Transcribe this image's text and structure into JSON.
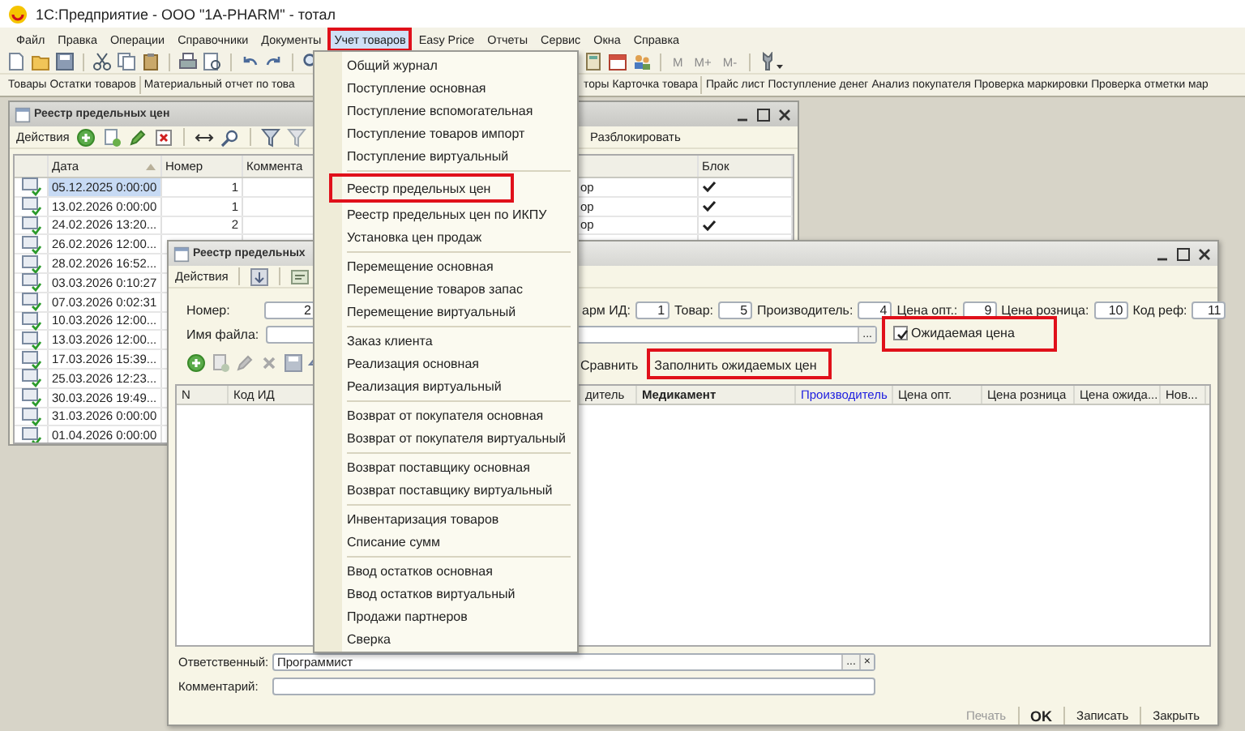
{
  "window": {
    "title": "1С:Предприятие - ООО \"1A-PHARM\" - тотал"
  },
  "menu_bar": [
    {
      "label": "Файл",
      "selected": false,
      "highlighted": false
    },
    {
      "label": "Правка",
      "selected": false,
      "highlighted": false
    },
    {
      "label": "Операции",
      "selected": false,
      "highlighted": false
    },
    {
      "label": "Справочники",
      "selected": false,
      "highlighted": false
    },
    {
      "label": "Документы",
      "selected": false,
      "highlighted": false
    },
    {
      "label": "Учет товаров",
      "selected": true,
      "highlighted": true
    },
    {
      "label": "Easy Price",
      "selected": false,
      "highlighted": false
    },
    {
      "label": "Отчеты",
      "selected": false,
      "highlighted": false
    },
    {
      "label": "Сервис",
      "selected": false,
      "highlighted": false
    },
    {
      "label": "Окна",
      "selected": false,
      "highlighted": false
    },
    {
      "label": "Справка",
      "selected": false,
      "highlighted": false
    }
  ],
  "toolbar": {
    "memory_buttons": [
      "М",
      "М+",
      "М-"
    ]
  },
  "quick_bar": {
    "left": [
      [
        "Товары",
        "Остатки товаров"
      ],
      [
        "Материальный отчет по това"
      ]
    ],
    "right": [
      [
        "торы",
        "Карточка товара"
      ],
      [
        "Прайс лист",
        "Поступление денег",
        "Анализ покупателя",
        "Проверка маркировки",
        "Проверка отметки мар"
      ]
    ]
  },
  "list_window": {
    "title": "Реестр предельных цен",
    "actions": "Действия",
    "unblock_button": "Разблокировать",
    "columns": [
      "Дата",
      "Номер",
      "Коммента"
    ],
    "block_column": "Блок",
    "rows": [
      {
        "date": "05.12.2025 0:00:00",
        "number": "1",
        "column_5": "ор",
        "blocked": true,
        "selected": true
      },
      {
        "date": "13.02.2026 0:00:00",
        "number": "1",
        "column_5": "ор",
        "blocked": true,
        "selected": false
      },
      {
        "date": "24.02.2026 13:20...",
        "number": "2",
        "column_5": "ор",
        "blocked": true,
        "selected": false
      },
      {
        "date": "26.02.2026 12:00...",
        "selected": false
      },
      {
        "date": "28.02.2026 16:52...",
        "selected": false
      },
      {
        "date": "03.03.2026 0:10:27",
        "selected": false
      },
      {
        "date": "07.03.2026 0:02:31",
        "selected": false
      },
      {
        "date": "10.03.2026 12:00...",
        "selected": false
      },
      {
        "date": "13.03.2026 12:00...",
        "selected": false
      },
      {
        "date": "17.03.2026 15:39...",
        "selected": false
      },
      {
        "date": "25.03.2026 12:23...",
        "selected": false
      },
      {
        "date": "30.03.2026 19:49...",
        "selected": false
      },
      {
        "date": "31.03.2026 0:00:00",
        "selected": false
      },
      {
        "date": "01.04.2026 0:00:00",
        "selected": false
      }
    ]
  },
  "form_window": {
    "title": "Реестр предельных",
    "actions": "Действия",
    "number": {
      "label": "Номер:",
      "value": "2"
    },
    "id_fields": [
      {
        "label": "арм ИД:",
        "value": "1"
      },
      {
        "label": "Товар:",
        "value": "5"
      },
      {
        "label": "Производитель:",
        "value": "4"
      },
      {
        "label": "Цена опт.:",
        "value": "9"
      },
      {
        "label": "Цена розница:",
        "value": "10"
      },
      {
        "label": "Код реф:",
        "value": "11"
      }
    ],
    "file": {
      "label": "Имя файла:",
      "select_button": "..."
    },
    "expected_price": {
      "label": "Ожидаемая цена",
      "checked": true,
      "highlighted": true
    },
    "buttons": [
      {
        "label": "Сравнить",
        "highlighted": false
      },
      {
        "label": "Заполнить ожидаемых цен",
        "highlighted": true
      }
    ],
    "columns": [
      {
        "label": "N",
        "kind": "plain"
      },
      {
        "label": "Код ИД",
        "kind": "plain"
      },
      {
        "label": "дитель",
        "kind": "plain"
      },
      {
        "label": "Медикамент",
        "kind": "bold"
      },
      {
        "label": "Производитель",
        "kind": "link"
      },
      {
        "label": "Цена опт.",
        "kind": "plain"
      },
      {
        "label": "Цена розница",
        "kind": "plain"
      },
      {
        "label": "Цена ожида...",
        "kind": "plain"
      },
      {
        "label": "Нов...",
        "kind": "plain"
      }
    ],
    "responsible": {
      "label": "Ответственный:",
      "value": "Программист",
      "select_button": "...",
      "clear_button": "×"
    },
    "comment": {
      "label": "Комментарий:"
    },
    "footer": [
      {
        "label": "Печать",
        "disabled": true,
        "default": false
      },
      {
        "label": "OK",
        "disabled": false,
        "default": true
      },
      {
        "label": "Записать",
        "disabled": false,
        "default": false
      },
      {
        "label": "Закрыть",
        "disabled": false,
        "default": false
      }
    ]
  },
  "dropdown_menu": {
    "groups": [
      [
        {
          "label": "Общий журнал",
          "highlighted": false
        },
        {
          "label": "Поступление основная",
          "highlighted": false
        },
        {
          "label": "Поступление вспомогательная",
          "highlighted": false
        },
        {
          "label": "Поступление товаров импорт",
          "highlighted": false
        },
        {
          "label": "Поступление виртуальный",
          "highlighted": false
        }
      ],
      [
        {
          "label": "Реестр предельных цен",
          "highlighted": true
        },
        {
          "label": "Реестр предельных цен по ИКПУ",
          "highlighted": false
        },
        {
          "label": "Установка цен продаж",
          "highlighted": false
        }
      ],
      [
        {
          "label": "Перемещение основная",
          "highlighted": false
        },
        {
          "label": "Перемещение товаров запас",
          "highlighted": false
        },
        {
          "label": "Перемещение виртуальный",
          "highlighted": false
        }
      ],
      [
        {
          "label": "Заказ клиента",
          "highlighted": false
        },
        {
          "label": "Реализация основная",
          "highlighted": false
        },
        {
          "label": "Реализация виртуальный",
          "highlighted": false
        }
      ],
      [
        {
          "label": "Возврат от покупателя основная",
          "highlighted": false
        },
        {
          "label": "Возврат от покупателя виртуальный",
          "highlighted": false
        }
      ],
      [
        {
          "label": "Возврат поставщику основная",
          "highlighted": false
        },
        {
          "label": "Возврат поставщику виртуальный",
          "highlighted": false
        }
      ],
      [
        {
          "label": "Инвентаризация товаров",
          "highlighted": false
        },
        {
          "label": "Списание сумм",
          "highlighted": false
        }
      ],
      [
        {
          "label": "Ввод остатков основная",
          "highlighted": false
        },
        {
          "label": "Ввод остатков виртуальный",
          "highlighted": false
        },
        {
          "label": "Продажи партнеров",
          "highlighted": false
        },
        {
          "label": "Сверка",
          "highlighted": false
        }
      ]
    ]
  }
}
